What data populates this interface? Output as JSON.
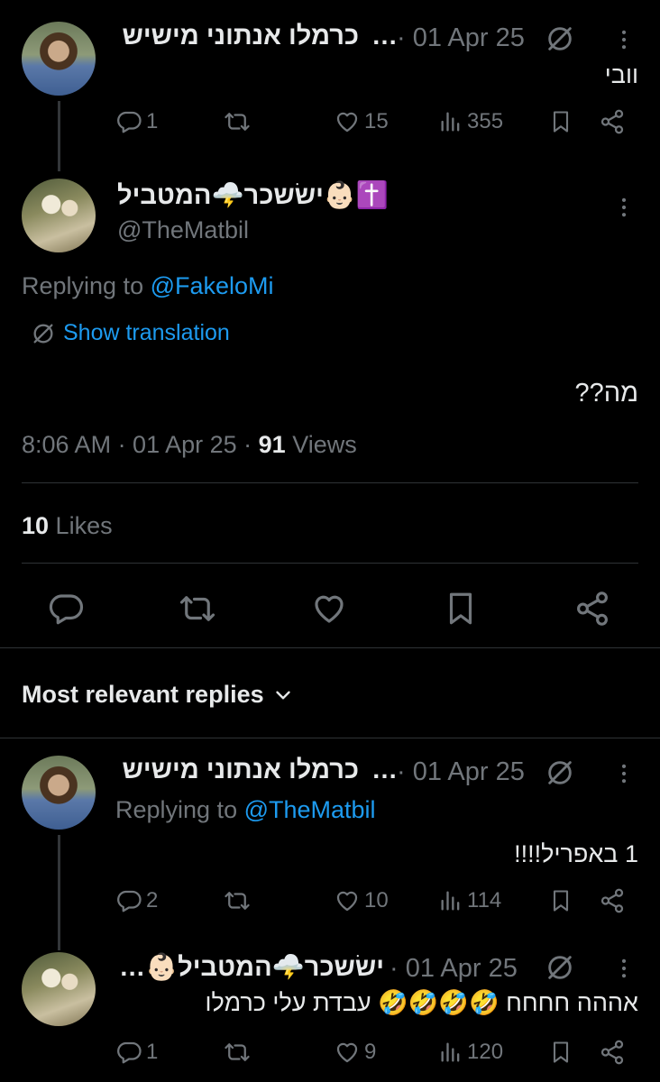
{
  "tweet1": {
    "author": "כרמלו אנתוני מישיש",
    "ellipsis": "…",
    "date": "· 01 Apr 25",
    "text": "וובי",
    "replies": "1",
    "likes": "15",
    "views": "355"
  },
  "main": {
    "author": "ישׂשכר🌩️המטביל👶🏻✝️",
    "handle": "@TheMatbil",
    "replying_prefix": "Replying to ",
    "replying_handle": "@FakeloMi",
    "show_translation": "Show translation",
    "text": "מה??",
    "time": "8:06 AM · 01 Apr 25 · ",
    "views_count": "91",
    "views_label": " Views",
    "likes_count": "10",
    "likes_label": " Likes"
  },
  "sort": {
    "label": "Most relevant replies"
  },
  "reply1": {
    "author": "כרמלו אנתוני מישיש",
    "ellipsis": "…",
    "date": "· 01 Apr 25",
    "replying_prefix": "Replying to ",
    "replying_handle": "@TheMatbil",
    "text": "1 באפריל!!!!",
    "replies": "2",
    "likes": "10",
    "views": "114"
  },
  "reply2": {
    "author": "ישׂשכר🌩️המטביל👶🏻…",
    "date": "· 01 Apr 25",
    "text": "אההה חחחח 🤣🤣🤣🤣 עבדת עלי כרמלו",
    "replies": "1",
    "likes": "9",
    "views": "120"
  },
  "icons": {
    "reply": "reply-icon",
    "retweet": "retweet-icon",
    "like": "heart-icon",
    "views": "views-icon",
    "bookmark": "bookmark-icon",
    "share": "share-icon",
    "more": "more-icon",
    "translate": "translate-icon"
  },
  "colors": {
    "background": "#000000",
    "text": "#e7e9ea",
    "secondary": "#71767b",
    "link": "#1d9bf0",
    "divider": "#2f3336"
  }
}
